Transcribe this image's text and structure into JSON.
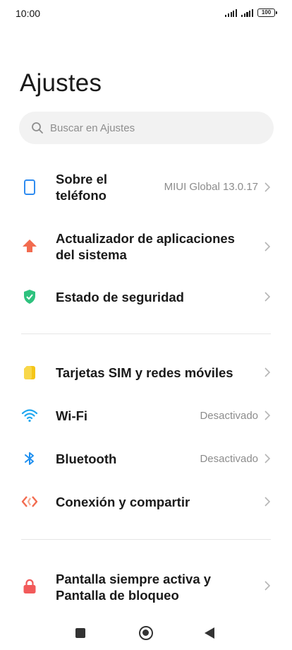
{
  "status": {
    "time": "10:00",
    "battery": "100"
  },
  "title": "Ajustes",
  "search": {
    "placeholder": "Buscar en Ajustes"
  },
  "items": [
    {
      "label_line1": "Sobre el",
      "label_line2": "teléfono",
      "value": "MIUI Global 13.0.17",
      "icon": "phone-icon"
    },
    {
      "label_line1": "Actualizador de aplicaciones",
      "label_line2": "del sistema",
      "value": "",
      "icon": "update-arrow-icon"
    },
    {
      "label_line1": "Estado de seguridad",
      "value": "",
      "icon": "shield-check-icon"
    },
    {
      "label_line1": "Tarjetas SIM y redes móviles",
      "value": "",
      "icon": "sim-card-icon"
    },
    {
      "label_line1": "Wi-Fi",
      "value": "Desactivado",
      "icon": "wifi-icon"
    },
    {
      "label_line1": "Bluetooth",
      "value": "Desactivado",
      "icon": "bluetooth-icon"
    },
    {
      "label_line1": "Conexión y compartir",
      "value": "",
      "icon": "connection-share-icon"
    },
    {
      "label_line1": "Pantalla siempre activa y",
      "label_line2": "Pantalla de bloqueo",
      "value": "",
      "icon": "lock-icon"
    }
  ],
  "colors": {
    "phone": "#2f8cf0",
    "update": "#f26b4f",
    "security": "#2ec27e",
    "sim": "#f5c518",
    "wifi": "#1ea7f0",
    "bluetooth": "#1e8ff0",
    "connection": "#f26b4f",
    "lock": "#f25a5a"
  }
}
